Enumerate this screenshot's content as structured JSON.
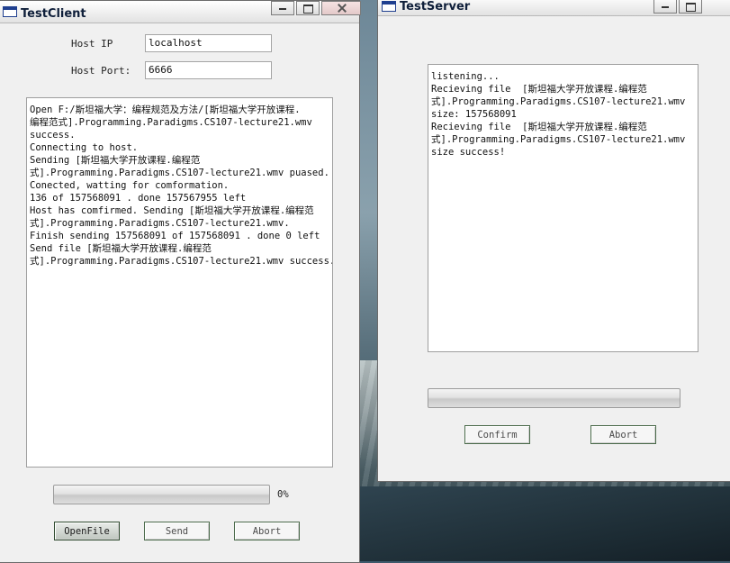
{
  "client": {
    "title": "TestClient",
    "host_ip_label": "Host IP",
    "host_ip_value": "localhost",
    "host_port_label": "Host Port:",
    "host_port_value": "6666",
    "log_lines": [
      "Open F:/斯坦福大学：编程规范及方法/[斯坦福大学开放课程.",
      "编程范式].Programming.Paradigms.CS107-lecture21.wmv",
      "success.",
      "Connecting to host.",
      "Sending [斯坦福大学开放课程.编程范",
      "式].Programming.Paradigms.CS107-lecture21.wmv puased.",
      "Conected, watting for comformation.",
      "136 of 157568091 . done 157567955 left",
      "Host has comfirmed. Sending [斯坦福大学开放课程.编程范",
      "式].Programming.Paradigms.CS107-lecture21.wmv.",
      "Finish sending 157568091 of 157568091 . done 0 left",
      "Send file [斯坦福大学开放课程.编程范",
      "式].Programming.Paradigms.CS107-lecture21.wmv success."
    ],
    "progress_text": "0%",
    "progress_value": 0,
    "buttons": {
      "openfile": "OpenFile",
      "send": "Send",
      "abort": "Abort"
    }
  },
  "server": {
    "title": "TestServer",
    "log_lines": [
      "listening...",
      "Recieving file  [斯坦福大学开放课程.编程范",
      "式].Programming.Paradigms.CS107-lecture21.wmv",
      "size: 157568091",
      "Recieving file  [斯坦福大学开放课程.编程范",
      "式].Programming.Paradigms.CS107-lecture21.wmv",
      "size success!"
    ],
    "progress_value": 0,
    "buttons": {
      "confirm": "Confirm",
      "abort": "Abort"
    }
  },
  "colors": {
    "progress_fill": "#6fbf5a",
    "title_text": "#0f1f3a"
  },
  "icons": {
    "window_icon": "window-app-icon",
    "minimize": "minimize-icon",
    "maximize": "maximize-icon",
    "close": "close-icon"
  }
}
